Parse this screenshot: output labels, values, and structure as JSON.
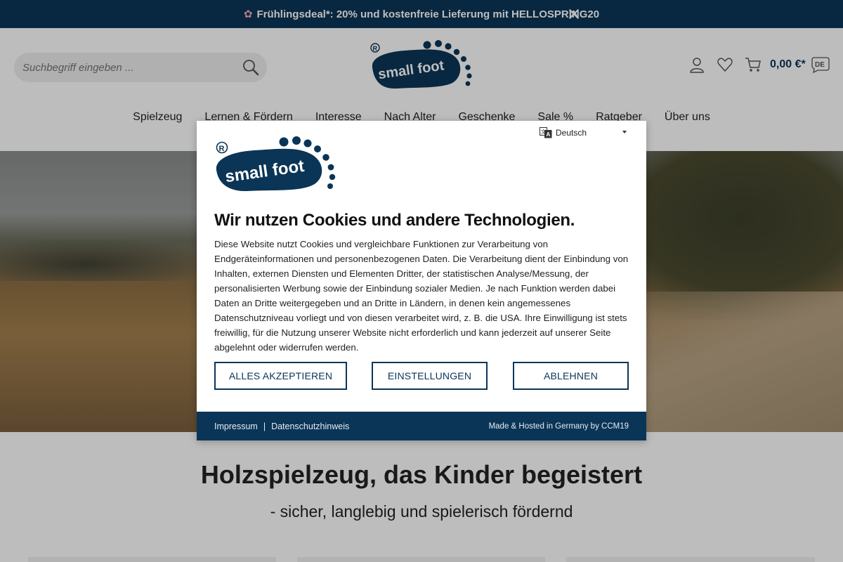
{
  "promo": {
    "text": "Frühlingsdeal*: 20% und kostenfreie Lieferung mit HELLOSPRING20",
    "icon": "flower-icon",
    "close_icon": "close-icon"
  },
  "header": {
    "search_placeholder": "Suchbegriff eingeben ...",
    "logo_text": "small foot",
    "cart_total": "0,00 €*",
    "icons": [
      "user-icon",
      "heart-icon",
      "cart-icon",
      "language-de-icon"
    ]
  },
  "nav": {
    "items": [
      "Spielzeug",
      "Lernen & Fördern",
      "Interesse",
      "Nach Alter",
      "Geschenke",
      "Sale %",
      "Ratgeber",
      "Über uns"
    ]
  },
  "hero": {
    "headline": "Holzspielzeug, das Kinder begeistert",
    "subline": "- sicher, langlebig und spielerisch fördernd"
  },
  "cookie": {
    "language": "Deutsch",
    "logo_text": "small foot",
    "title": "Wir nutzen Cookies und andere Technologien.",
    "body": "Diese Website nutzt Cookies und vergleichbare Funktionen zur Verarbeitung von Endgeräteinformationen und personenbezogenen Daten. Die Verarbeitung dient der Einbindung von Inhalten, externen Diensten und Elementen Dritter, der statistischen Analyse/Messung, der personalisierten Werbung sowie der Einbindung sozialer Medien. Je nach Funktion werden dabei Daten an Dritte weitergegeben und an Dritte in Ländern, in denen kein angemessenes Datenschutzniveau vorliegt und von diesen verarbeitet wird, z. B. die USA. Ihre Einwilligung ist stets freiwillig, für die Nutzung unserer Website nicht erforderlich und kann jederzeit auf unserer Seite abgelehnt oder widerrufen werden.",
    "accept_label": "ALLES AKZEPTIEREN",
    "settings_label": "EINSTELLUNGEN",
    "decline_label": "ABLEHNEN",
    "footer": {
      "imprint": "Impressum",
      "privacy": "Datenschutzhinweis",
      "made_by": "Made & Hosted in Germany by CCM19"
    }
  },
  "colors": {
    "brand": "#0b3557",
    "promo_bg": "#0b3557",
    "search_bg": "#eeeeee"
  }
}
